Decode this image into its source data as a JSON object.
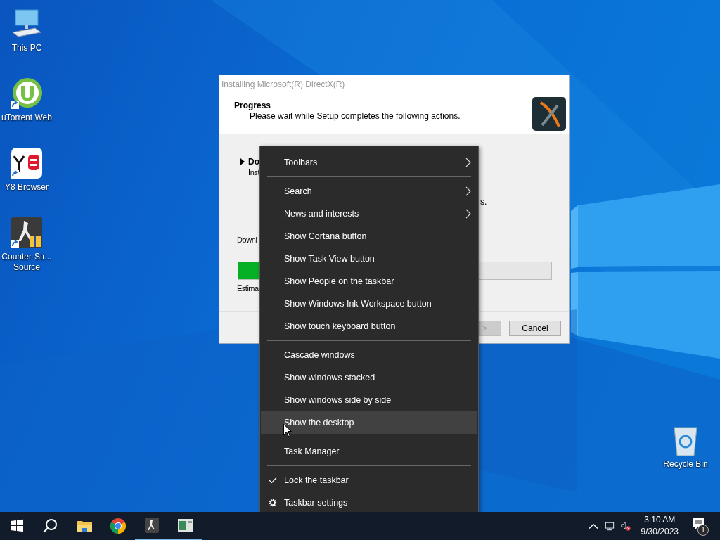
{
  "desktop_icons": [
    {
      "label": "This PC",
      "kind": "pc",
      "shortcut": false
    },
    {
      "label": "uTorrent Web",
      "kind": "torrent",
      "shortcut": true
    },
    {
      "label": "Y8 Browser",
      "kind": "y8",
      "shortcut": true
    },
    {
      "label": "Counter-Str...\nSource",
      "kind": "game",
      "shortcut": true
    }
  ],
  "recycle_bin": {
    "label": "Recycle Bin"
  },
  "dialog": {
    "title": "Installing Microsoft(R) DirectX(R)",
    "heading": "Progress",
    "subheading": "Please wait while Setup completes the following actions.",
    "step": {
      "title": "Do",
      "detail": "Inst"
    },
    "status_tail": "s.",
    "download_label": "Downl",
    "progress": {
      "level": 0.08
    },
    "estimate_label": "Estima",
    "buttons": [
      {
        "label": ">",
        "disabled": true,
        "kind": "next"
      },
      {
        "label": "Cancel",
        "disabled": false,
        "kind": "cancel"
      }
    ]
  },
  "menu": {
    "groups": [
      {
        "items": [
          {
            "label": "Toolbars",
            "kind": "submenu",
            "selected": false
          }
        ]
      },
      {
        "items": [
          {
            "label": "Search",
            "kind": "submenu",
            "selected": false
          },
          {
            "label": "News and interests",
            "kind": "submenu",
            "selected": false
          },
          {
            "label": "Show Cortana button",
            "kind": "command",
            "selected": false
          },
          {
            "label": "Show Task View button",
            "kind": "command",
            "selected": false
          },
          {
            "label": "Show People on the taskbar",
            "kind": "command",
            "selected": false
          },
          {
            "label": "Show Windows Ink Workspace button",
            "kind": "command",
            "selected": false
          },
          {
            "label": "Show touch keyboard button",
            "kind": "command",
            "selected": false
          }
        ]
      },
      {
        "items": [
          {
            "label": "Cascade windows",
            "kind": "command",
            "selected": false
          },
          {
            "label": "Show windows stacked",
            "kind": "command",
            "selected": false
          },
          {
            "label": "Show windows side by side",
            "kind": "command",
            "selected": false
          },
          {
            "label": "Show the desktop",
            "kind": "command",
            "selected": true
          }
        ]
      },
      {
        "items": [
          {
            "label": "Task Manager",
            "kind": "command",
            "selected": false
          }
        ]
      },
      {
        "items": [
          {
            "label": "Lock the taskbar",
            "kind": "toggle",
            "checked": true,
            "selected": false
          },
          {
            "label": "Taskbar settings",
            "kind": "settings",
            "selected": false
          }
        ]
      }
    ]
  },
  "taskbar": {
    "apps": [
      {
        "kind": "start",
        "running": false
      },
      {
        "kind": "search",
        "running": false
      },
      {
        "kind": "folder",
        "running": false
      },
      {
        "kind": "browser",
        "running": false
      },
      {
        "kind": "game",
        "running": true
      },
      {
        "kind": "window",
        "running": true
      }
    ],
    "time": "3:10 AM",
    "date": "9/30/2023",
    "notification_count": "1"
  }
}
